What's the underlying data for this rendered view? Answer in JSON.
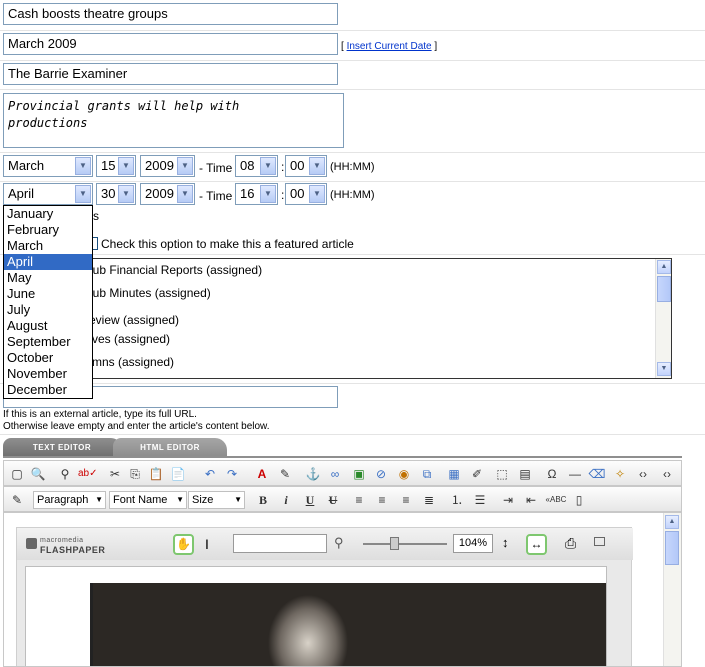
{
  "fields": {
    "title": "Cash boosts theatre groups",
    "date": "March 2009",
    "insert_date_link": "Insert Current Date",
    "source": "The Barrie Examiner",
    "summary_line1": "Provincial grants will help with",
    "summary_line2": "productions"
  },
  "start": {
    "month": "March",
    "day": "15",
    "year": "2009",
    "time_label": "- Time",
    "hour": "08",
    "minute": "00",
    "format": "(HH:MM)"
  },
  "end": {
    "month": "April",
    "day": "30",
    "year": "2009",
    "time_label": "- Time",
    "hour": "16",
    "minute": "00",
    "format": "(HH:MM)"
  },
  "month_dropdown": {
    "options": [
      "January",
      "February",
      "March",
      "April",
      "May",
      "June",
      "July",
      "August",
      "September",
      "October",
      "November",
      "December"
    ],
    "selected": "April"
  },
  "partial_text_s": "s",
  "featured_label": "Check this option to make this a featured article",
  "categories": [
    "ing Club Financial Reports (assigned)",
    "ing Club Minutes (assigned)",
    "eview (assigned)",
    "ves (assigned)",
    "mns (assigned)"
  ],
  "url_hint_line1": "If this is an external article, type its full URL.",
  "url_hint_line2": "Otherwise leave empty and enter the article's content below.",
  "tabs": {
    "text_editor": "TEXT EDITOR",
    "html_editor": "HTML EDITOR"
  },
  "toolbar2": {
    "paragraph": "Paragraph",
    "font_name": "Font Name",
    "size": "Size"
  },
  "flash": {
    "brand_small": "macromedia",
    "brand_big": "FLASHPAPER",
    "zoom": "104%"
  },
  "colors": {
    "selection": "#316ac5",
    "field_border": "#7f9db9",
    "link": "#0033cc"
  }
}
